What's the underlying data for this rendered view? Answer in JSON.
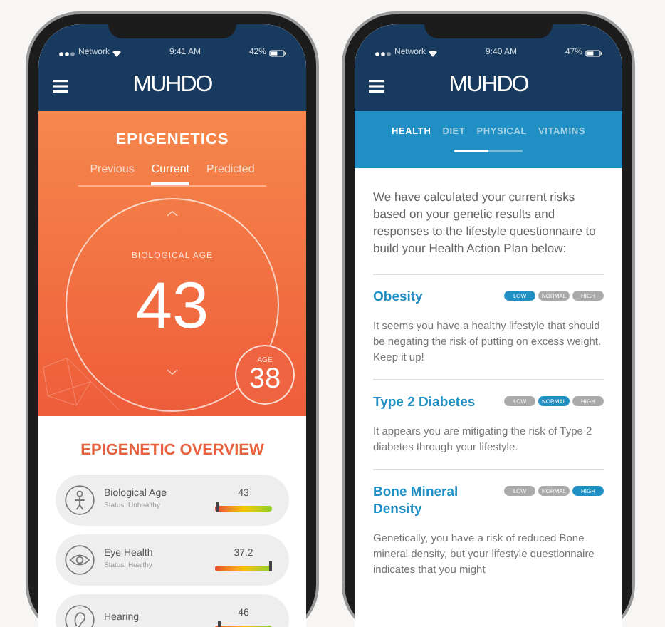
{
  "phones": [
    {
      "kind": "epigenetics",
      "status_bar": {
        "carrier": "Network",
        "time": "9:41 AM",
        "battery": "42%"
      },
      "logo": "MUHDO",
      "title": "EPIGENETICS",
      "tabs": [
        {
          "label": "Previous",
          "selected": false
        },
        {
          "label": "Current",
          "selected": true
        },
        {
          "label": "Predicted",
          "selected": false
        }
      ],
      "gauge": {
        "label": "BIOLOGICAL AGE",
        "value": "43"
      },
      "badge": {
        "label": "AGE",
        "value": "38"
      },
      "overview_title": "EPIGENETIC OVERVIEW",
      "metrics": [
        {
          "kind": "body",
          "name": "Biological Age",
          "status": "Status: Unhealthy",
          "value": "43",
          "level": 0.03
        },
        {
          "kind": "eye",
          "name": "Eye Health",
          "status": "Status: Healthy",
          "value": "37.2",
          "level": 0.95
        },
        {
          "kind": "ear",
          "name": "Hearing",
          "value": "46",
          "level": 0.05
        }
      ]
    },
    {
      "kind": "health",
      "status_bar": {
        "carrier": "Network",
        "time": "9:40 AM",
        "battery": "47%"
      },
      "logo": "MUHDO",
      "tabs": [
        {
          "label": "HEALTH",
          "selected": true
        },
        {
          "label": "DIET",
          "selected": false
        },
        {
          "label": "PHYSICAL",
          "selected": false
        },
        {
          "label": "VITAMINS",
          "selected": false
        }
      ],
      "intro": "We have calculated your current risks based on your genetic results and responses to the lifestyle questionnaire to build your Health Action Plan below:",
      "risks": [
        {
          "title": "Obesity",
          "levels": [
            {
              "label": "LOW",
              "selected": true
            },
            {
              "label": "NORMAL",
              "selected": false
            },
            {
              "label": "HIGH",
              "selected": false
            }
          ],
          "text": "It seems you have a healthy lifestyle that should be negating the risk of putting on excess weight. Keep it up!"
        },
        {
          "title": "Type 2 Diabetes",
          "levels": [
            {
              "label": "LOW",
              "selected": false
            },
            {
              "label": "NORMAL",
              "selected": true
            },
            {
              "label": "HIGH",
              "selected": false
            }
          ],
          "text": "It appears you are mitigating the risk of Type 2 diabetes through your lifestyle."
        },
        {
          "title": "Bone Mineral Density",
          "levels": [
            {
              "label": "LOW",
              "selected": false
            },
            {
              "label": "NORMAL",
              "selected": false
            },
            {
              "label": "HIGH",
              "selected": true
            }
          ],
          "text": "Genetically, you have a risk of reduced Bone mineral density, but your lifestyle questionnaire indicates that you might"
        }
      ]
    }
  ]
}
